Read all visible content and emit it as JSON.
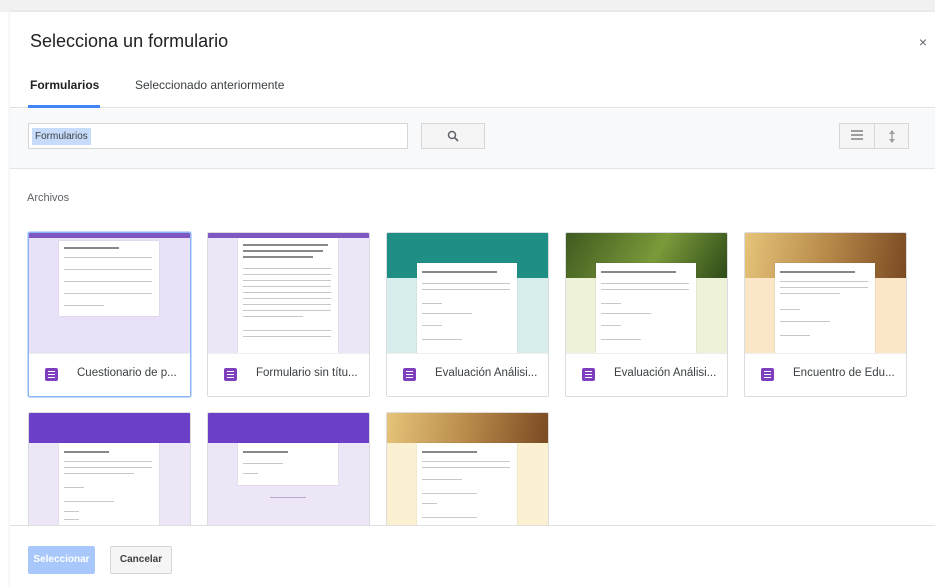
{
  "dialog": {
    "title": "Selecciona un formulario",
    "close_icon": "×"
  },
  "tabs": [
    {
      "label": "Formularios",
      "active": true
    },
    {
      "label": "Seleccionado anteriormente",
      "active": false
    }
  ],
  "search": {
    "value": "Formularios",
    "search_icon": "search-icon",
    "list_view_icon": "list-view-icon",
    "sort_icon": "sort-icon"
  },
  "section_label": "Archivos",
  "files": [
    {
      "name": "Cuestionario de p...",
      "theme": "#e9e1f7",
      "band": "#7e57c2",
      "selected": true
    },
    {
      "name": "Formulario sin títu...",
      "theme": "#ece6f6",
      "band": "#7e57c2",
      "selected": false
    },
    {
      "name": "Evaluación Análisi...",
      "theme": "#d8eeec",
      "band": "#1f8f86",
      "selected": false
    },
    {
      "name": "Evaluación Análisi...",
      "theme": "#eef2d9",
      "band": "#5d7a2c",
      "selected": false
    },
    {
      "name": "Encuentro de Edu...",
      "theme": "#fbe6c8",
      "band": "#8a5a2b",
      "selected": false
    },
    {
      "name": "",
      "theme": "#ece6f6",
      "band": "#6b3fc6",
      "selected": false
    },
    {
      "name": "",
      "theme": "#ece6f6",
      "band": "#6b3fc6",
      "selected": false
    },
    {
      "name": "",
      "theme": "#fbf1d2",
      "band": "#8a5a2b",
      "selected": false
    }
  ],
  "footer": {
    "select_label": "Seleccionar",
    "cancel_label": "Cancelar"
  },
  "colors": {
    "accent": "#4285f4",
    "form_icon": "#7e3fbf"
  }
}
